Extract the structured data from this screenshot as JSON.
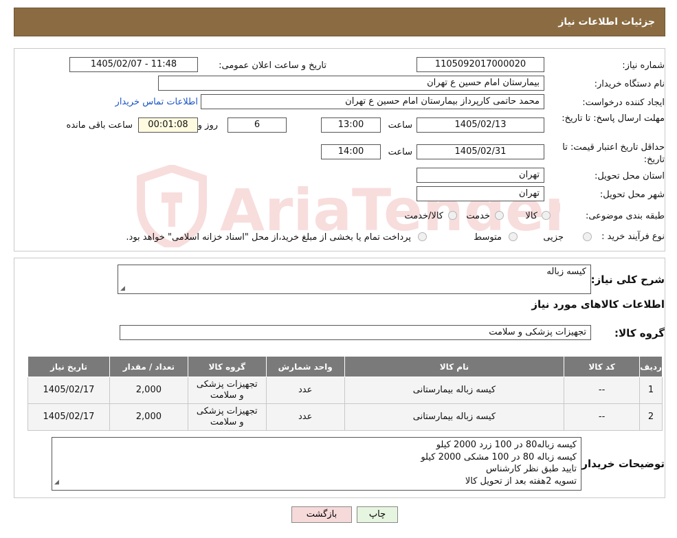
{
  "header": {
    "title": "جزئیات اطلاعات نیاز"
  },
  "form": {
    "need_number_label": "شماره نیاز:",
    "need_number": "1105092017000020",
    "announce_label": "تاریخ و ساعت اعلان عمومی:",
    "announce_value": "1405/02/07 - 11:48",
    "buyer_org_label": "نام دستگاه خریدار:",
    "buyer_org": "بیمارستان امام حسین  ع  تهران",
    "creator_label": "ایجاد کننده درخواست:",
    "creator": "محمد حاتمی کارپرداز بیمارستان امام حسین  ع  تهران",
    "contact_link": "اطلاعات تماس خریدار",
    "deadline_label": "مهلت ارسال پاسخ: تا تاریخ:",
    "deadline_date": "1405/02/13",
    "time_label": "ساعت",
    "deadline_time": "13:00",
    "days": "6",
    "days_label": "روز و",
    "remaining": "00:01:08",
    "remaining_label": "ساعت باقی مانده",
    "validity_label": "حداقل تاریخ اعتبار قیمت: تا تاریخ:",
    "validity_date": "1405/02/31",
    "validity_time": "14:00",
    "province_label": "استان محل تحویل:",
    "province": "تهران",
    "city_label": "شهر محل تحویل:",
    "city": "تهران",
    "category_label": "طبقه بندی موضوعی:",
    "category_options": [
      "کالا",
      "خدمت",
      "کالا/خدمت"
    ],
    "process_label": "نوع فرآیند خرید :",
    "process_options": [
      "جزیی",
      "متوسط"
    ],
    "process_note": "پرداخت تمام یا بخشی از مبلغ خرید،از محل \"اسناد خزانه اسلامی\" خواهد بود."
  },
  "summary": {
    "label": "شرح کلی نیاز:",
    "value": "کیسه زباله"
  },
  "goods": {
    "section_title": "اطلاعات کالاهای مورد نیاز",
    "group_label": "گروه کالا:",
    "group_value": "تجهیزات پزشکی و سلامت"
  },
  "table": {
    "headers": [
      "ردیف",
      "کد کالا",
      "نام کالا",
      "واحد شمارش",
      "گروه کالا",
      "تعداد / مقدار",
      "تاریخ نیاز"
    ],
    "rows": [
      [
        "1",
        "--",
        "کیسه زباله بیمارستانی",
        "عدد",
        "تجهیزات پزشکی و سلامت",
        "2,000",
        "1405/02/17"
      ],
      [
        "2",
        "--",
        "کیسه زباله بیمارستانی",
        "عدد",
        "تجهیزات پزشکی و سلامت",
        "2,000",
        "1405/02/17"
      ]
    ]
  },
  "buyer_notes": {
    "label": "توضیحات خریدار:",
    "lines": [
      "کیسه زباله80 در 100 زرد 2000 کیلو",
      "کیسه زباله 80 در 100 مشکی 2000 کیلو",
      "تایید طبق نظر کارشناس",
      "تسویه 2هفته بعد از تحویل کالا"
    ]
  },
  "buttons": {
    "print": "چاپ",
    "back": "بازگشت"
  },
  "watermark_text": "AriaTender.neT",
  "colors": {
    "header_bg": "#8b6c42",
    "table_header_bg": "#7a7a7a",
    "back_button_bg": "#f6d9d9",
    "print_button_bg": "#e6f5df"
  }
}
